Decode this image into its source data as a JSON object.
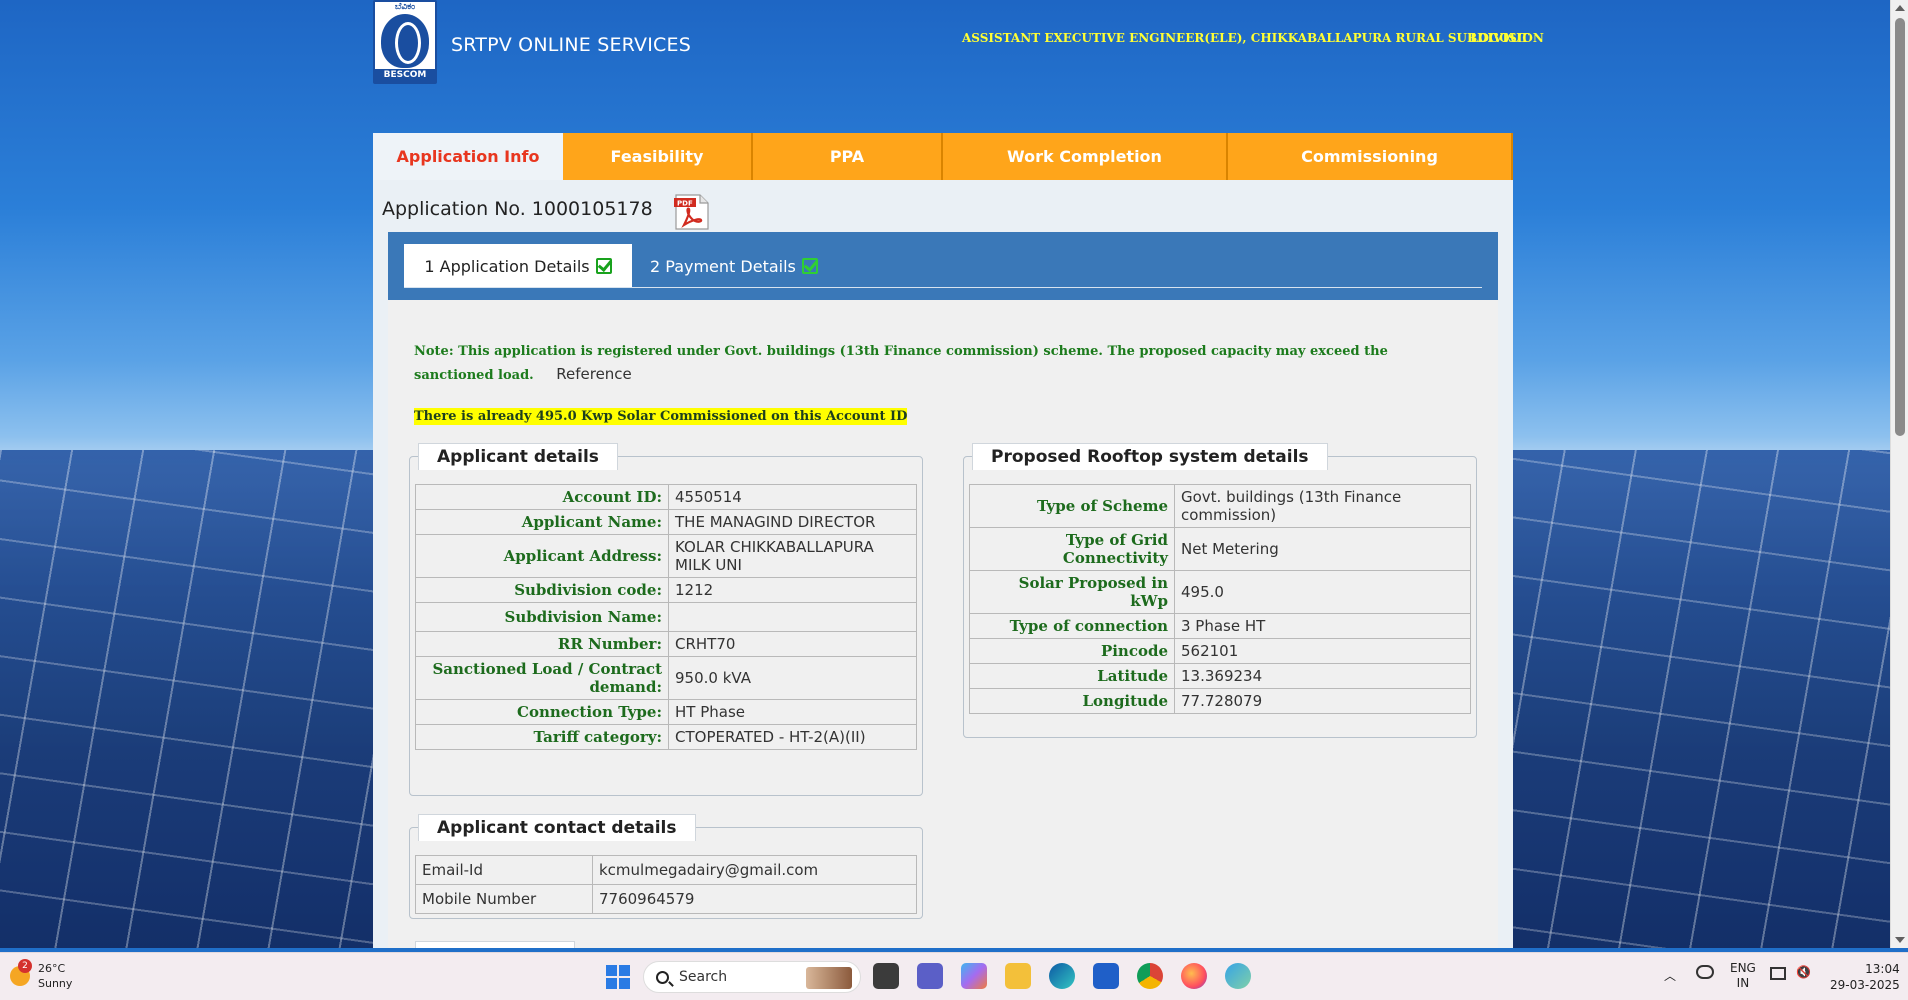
{
  "header": {
    "site_title": "SRTPV ONLINE SERVICES",
    "logo_top": "ಬೆವಿಕಂ",
    "logo_bottom": "BESCOM",
    "user": "ASSISTANT EXECUTIVE ENGINEER(ELE), CHIKKABALLAPURA RURAL SUBDIVISION",
    "logout": "LOGOUT"
  },
  "main_tabs": [
    "Application Info",
    "Feasibility",
    "PPA",
    "Work Completion",
    "Commissioning"
  ],
  "application": {
    "number_label": "Application No. 1000105178"
  },
  "sub_tabs": {
    "first": "1 Application Details",
    "second": "2 Payment Details"
  },
  "note": {
    "text": "Note: This application is registered under Govt. buildings (13th Finance commission) scheme. The proposed capacity may exceed the sanctioned load.",
    "reference": "Reference"
  },
  "highlight": "There is already 495.0 Kwp Solar Commissioned on this Account ID",
  "applicant": {
    "title": "Applicant details",
    "rows": [
      {
        "label": "Account ID:",
        "value": "4550514"
      },
      {
        "label": "Applicant Name:",
        "value": "THE MANAGIND DIRECTOR"
      },
      {
        "label": "Applicant Address:",
        "value": "KOLAR CHIKKABALLAPURA MILK UNI"
      },
      {
        "label": "Subdivision code:",
        "value": "1212"
      },
      {
        "label": "Subdivision Name:",
        "value": ""
      },
      {
        "label": "RR Number:",
        "value": "CRHT70"
      },
      {
        "label": "Sanctioned Load / Contract demand:",
        "value": "950.0 kVA"
      },
      {
        "label": "Connection Type:",
        "value": "HT Phase"
      },
      {
        "label": "Tariff category:",
        "value": "CTOPERATED - HT-2(A)(II)"
      }
    ]
  },
  "rooftop": {
    "title": "Proposed Rooftop system details",
    "rows": [
      {
        "label": "Type of Scheme",
        "value": "Govt. buildings (13th Finance commission)"
      },
      {
        "label": "Type of Grid Connectivity",
        "value": "Net Metering"
      },
      {
        "label": "Solar Proposed in kWp",
        "value": "495.0"
      },
      {
        "label": "Type of connection",
        "value": "3 Phase HT"
      },
      {
        "label": "Pincode",
        "value": "562101"
      },
      {
        "label": "Latitude",
        "value": "13.369234"
      },
      {
        "label": "Longitude",
        "value": "77.728079"
      }
    ]
  },
  "contact": {
    "title": "Applicant contact details",
    "rows": [
      {
        "label": "Email-Id",
        "value": "kcmulmegadairy@gmail.com"
      },
      {
        "label": "Mobile Number",
        "value": "7760964579"
      }
    ]
  },
  "taskbar": {
    "weather_temp": "26°C",
    "weather_desc": "Sunny",
    "weather_badge": "2",
    "search_placeholder": "Search",
    "lang_top": "ENG",
    "lang_bottom": "IN",
    "time": "13:04",
    "date": "29-03-2025"
  },
  "colors": {
    "tab_orange": "#ffa51a",
    "active_tab_text": "#e8361f",
    "label_green": "#1d6b1d",
    "header_yellow": "#ffff33"
  }
}
